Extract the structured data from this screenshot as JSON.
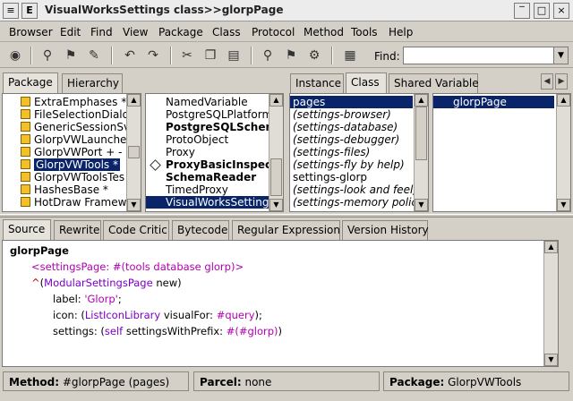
{
  "window": {
    "title": "VisualWorksSettings class>>glorpPage",
    "system_menu_glyph": "≡",
    "e_glyph": "E"
  },
  "menubar": [
    "Browser",
    "Edit",
    "Find",
    "View",
    "Package",
    "Class",
    "Protocol",
    "Method",
    "Tools",
    "Help"
  ],
  "toolbar": {
    "find_label": "Find:",
    "find_value": ""
  },
  "left_tabs": [
    "Package",
    "Hierarchy"
  ],
  "packages": [
    "ExtraEmphases *",
    "FileSelectionDialo",
    "GenericSessionSv",
    "GlorpVWLaunche",
    "GlorpVWPort + -",
    "GlorpVWTools *",
    "GlorpVWToolsTes",
    "HashesBase *",
    "HotDraw Framewo"
  ],
  "packages_selected_index": 5,
  "classes": [
    "NamedVariable",
    "PostgreSQLPlatform",
    "PostgreSQLSchem",
    "ProtoObject",
    "Proxy",
    "ProxyBasicInspecto",
    "SchemaReader",
    "TimedProxy",
    "VisualWorksSettings"
  ],
  "classes_selected_index": 8,
  "right_tabs": [
    "Instance",
    "Class",
    "Shared Variable"
  ],
  "right_tabs_active_index": 1,
  "protocols": [
    "pages",
    "(settings-browser)",
    "(settings-database)",
    "(settings-debugger)",
    "(settings-files)",
    "(settings-fly by help)",
    "settings-glorp",
    "(settings-look and feel)",
    "(settings-memory policy)"
  ],
  "protocols_selected_index": 0,
  "methods": [
    "glorpPage"
  ],
  "methods_selected_index": 0,
  "editor_tabs": [
    "Source",
    "Rewrite",
    "Code Critic",
    "Bytecode",
    "Regular Expression",
    "Version History"
  ],
  "editor_tabs_active_index": 0,
  "code": {
    "l1": "glorpPage",
    "l2a": "<settingsPage: ",
    "l2b": "#(tools database glorp)",
    "l2c": ">",
    "l3a": "^",
    "l3b": "(",
    "l3c": "ModularSettingsPage",
    "l3d": " new)",
    "l4a": "label: ",
    "l4b": "'Glorp'",
    "l4c": ";",
    "l5a": "icon: (",
    "l5b": "ListIconLibrary",
    "l5c": " visualFor: ",
    "l5d": "#query",
    "l5e": ");",
    "l6a": "settings: (",
    "l6b": "self",
    "l6c": " settingsWithPrefix: ",
    "l6d": "#(#glorp)",
    "l6e": ")"
  },
  "status": {
    "method_label": "Method:",
    "method_value": "#glorpPage (pages)",
    "parcel_label": "Parcel:",
    "parcel_value": "none",
    "package_label": "Package:",
    "package_value": "GlorpVWTools"
  },
  "colors": {
    "selection": "#0a246a",
    "window_bg": "#d4d0c8",
    "syntax_symbol": "#b000b0",
    "syntax_return": "#cc0000"
  }
}
